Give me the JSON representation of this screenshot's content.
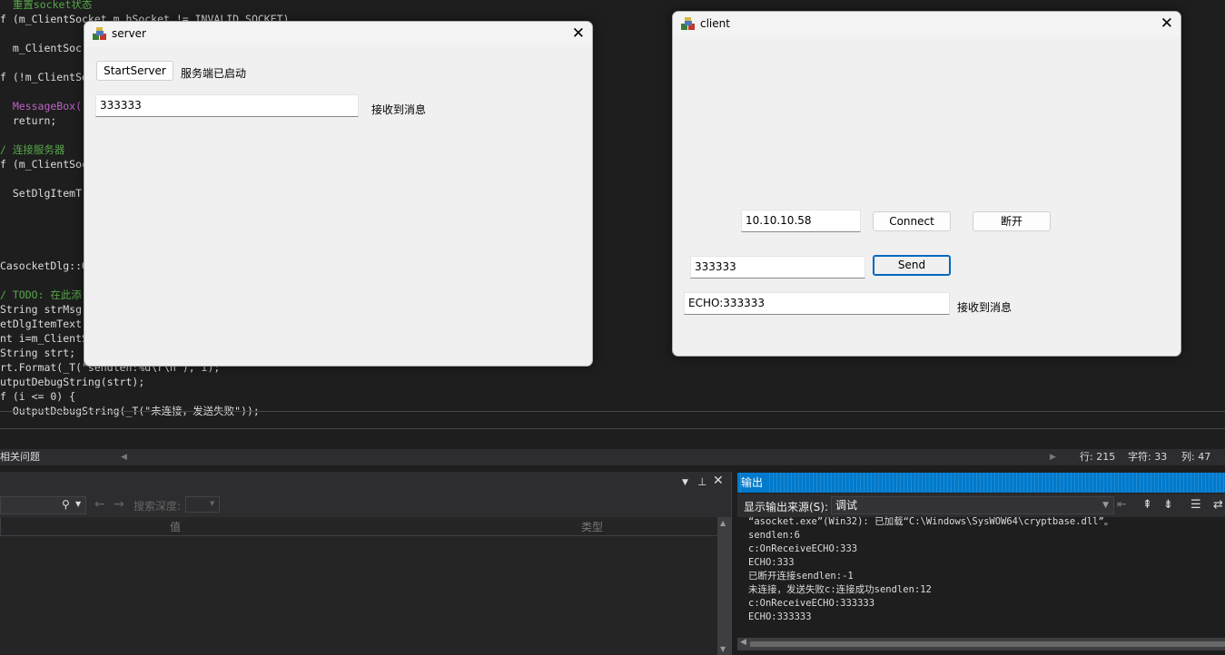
{
  "code": {
    "lines": [
      {
        "text": "  重置socket状态",
        "kind": "comment"
      },
      {
        "text": "f (m_ClientSocket.m_hSocket != INVALID_SOCKET)",
        "kind": "macro"
      },
      {
        "text": "",
        "kind": "normal"
      },
      {
        "text": "  m_ClientSoc",
        "kind": "normal"
      },
      {
        "text": "",
        "kind": "normal"
      },
      {
        "text": "f (!m_ClientSo",
        "kind": "normal"
      },
      {
        "text": "",
        "kind": "normal"
      },
      {
        "text": "  MessageBox(",
        "kind": "hl"
      },
      {
        "text": "  return;",
        "kind": "normal"
      },
      {
        "text": "",
        "kind": "normal"
      },
      {
        "text": "/ 连接服务器",
        "kind": "comment"
      },
      {
        "text": "f (m_ClientSoc",
        "kind": "normal"
      },
      {
        "text": "",
        "kind": "normal"
      },
      {
        "text": "  SetDlgItemT",
        "kind": "normal"
      },
      {
        "text": "",
        "kind": "normal"
      },
      {
        "text": "",
        "kind": "normal"
      },
      {
        "text": "",
        "kind": "normal"
      },
      {
        "text": "",
        "kind": "normal"
      },
      {
        "text": "CasocketDlg::O",
        "kind": "normal"
      },
      {
        "text": "",
        "kind": "normal"
      },
      {
        "text": "/ TODO: 在此添",
        "kind": "comment"
      },
      {
        "text": "String strMsg;",
        "kind": "normal"
      },
      {
        "text": "etDlgItemText(",
        "kind": "normal"
      },
      {
        "text": "nt i=m_ClientS",
        "kind": "normal"
      },
      {
        "text": "String strt;",
        "kind": "normal"
      },
      {
        "text": "rt.Format(_T(\"sendlen:%d\\r\\n\"), i);",
        "kind": "normal"
      },
      {
        "text": "utputDebugString(strt);",
        "kind": "normal"
      },
      {
        "text": "f (i <= 0) {",
        "kind": "normal"
      },
      {
        "text": "  OutputDebugString(_T(\"未连接，发送失败\"));",
        "kind": "normal"
      }
    ]
  },
  "status": {
    "panel_label": "相关问题",
    "line": "行: 215",
    "char": "字符: 33",
    "col": "列: 47"
  },
  "watch": {
    "depth_label": "搜索深度:",
    "col_value": "值",
    "col_type": "类型"
  },
  "output": {
    "title": "输出",
    "source_label": "显示输出来源(S):",
    "source_value": "调试",
    "lines": [
      "“asocket.exe”(Win32): 已加载“C:\\Windows\\SysWOW64\\cryptbase.dll”。",
      "sendlen:6",
      "c:OnReceiveECHO:333",
      "ECHO:333",
      "已断开连接sendlen:-1",
      "未连接，发送失败c:连接成功sendlen:12",
      "c:OnReceiveECHO:333333",
      "ECHO:333333"
    ]
  },
  "server": {
    "title": "server",
    "start_button": "StartServer",
    "status_text": "服务端已启动",
    "message_value": "333333",
    "received_label": "接收到消息"
  },
  "client": {
    "title": "client",
    "ip_value": "10.10.10.58",
    "connect_button": "Connect",
    "disconnect_button": "断开",
    "send_value": "333333",
    "send_button": "Send",
    "received_value": "ECHO:333333",
    "received_label": "接收到消息"
  }
}
